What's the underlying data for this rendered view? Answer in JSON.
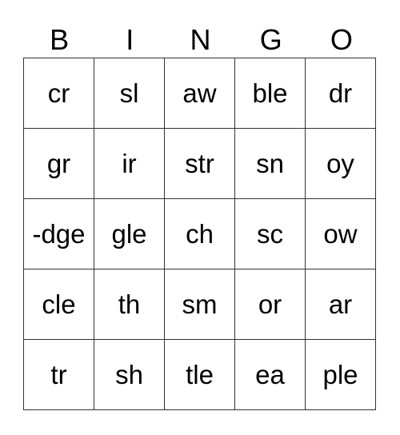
{
  "header": [
    "B",
    "I",
    "N",
    "G",
    "O"
  ],
  "rows": [
    [
      "cr",
      "sl",
      "aw",
      "ble",
      "dr"
    ],
    [
      "gr",
      "ir",
      "str",
      "sn",
      "oy"
    ],
    [
      "-dge",
      "gle",
      "ch",
      "sc",
      "ow"
    ],
    [
      "cle",
      "th",
      "sm",
      "or",
      "ar"
    ],
    [
      "tr",
      "sh",
      "tle",
      "ea",
      "ple"
    ]
  ]
}
